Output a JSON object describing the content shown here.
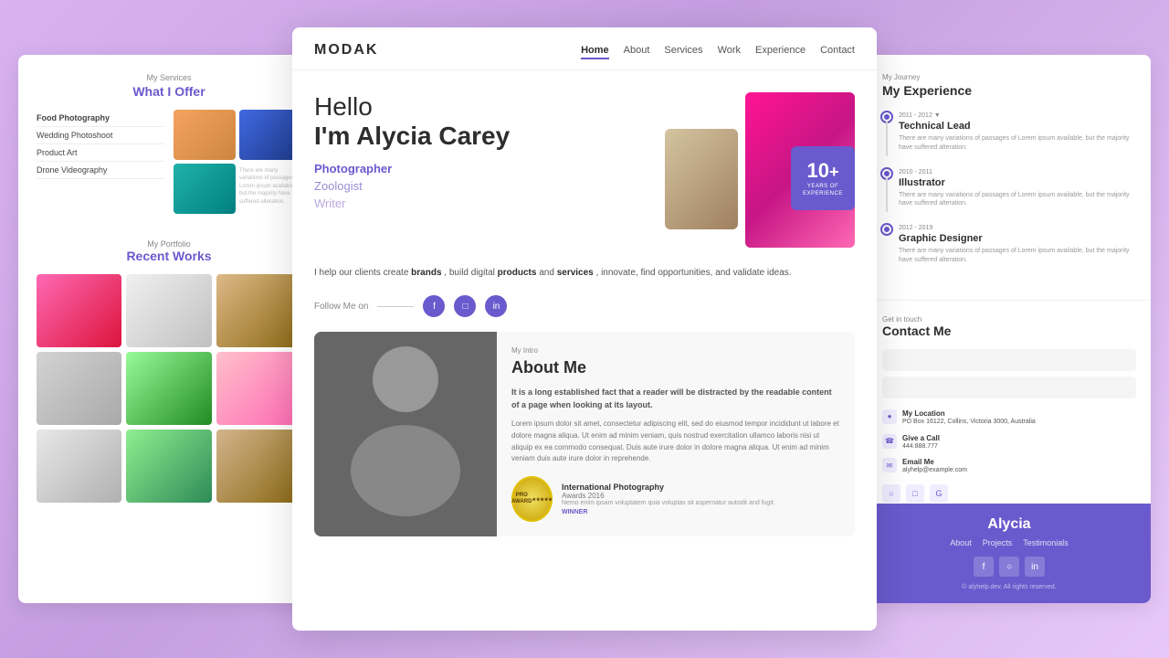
{
  "brand": {
    "logo": "MODAK"
  },
  "nav": {
    "links": [
      "Home",
      "About",
      "Services",
      "Work",
      "Experience",
      "Contact"
    ],
    "active": "Home"
  },
  "hero": {
    "greeting": "Hello",
    "intro": "I'm ",
    "name": "Alycia Carey",
    "roles": [
      "Photographer",
      "Zoologist",
      "Writer"
    ],
    "description": "I help our clients create",
    "desc_brands": "brands",
    "desc_mid": ", build digital",
    "desc_products": "products",
    "desc_and": "and",
    "desc_services": "services",
    "desc_end": ", innovate, find opportunities, and validate ideas.",
    "follow_label": "Follow Me on",
    "experience": {
      "number": "10",
      "plus": "+",
      "line1": "YEARS OF",
      "line2": "EXPERIENCE"
    }
  },
  "about": {
    "section_label": "My Intro",
    "title": "About Me",
    "tagline": "It is a long established fact that a reader will be distracted by the readable content of a page when looking at its layout.",
    "body": "Lorem ipsum dolor sit amet, consectetur adipiscing elit, sed do eiusmod tempor incididunt ut labore et dolore magna aliqua. Ut enim ad minim veniam, quis nostrud exercitation ullamco laboris nisi ut aliquip ex ea commodo consequat. Duis aute irure dolor in dolore magna aliqua. Ut enim ad minim veniam duis aute irure dolor in reprehende.",
    "award": {
      "badge": "PRO\nAWARD",
      "name": "International Photography",
      "year": "Awards 2016",
      "desc": "Nemo enim ipsam voluptatem quia voluptas sit aspernatur autodit and fugit.",
      "winner": "WINNER"
    }
  },
  "experience": {
    "section_label": "My Journey",
    "title": "My Experience",
    "items": [
      {
        "years": "2011 - 2012 ▼",
        "role": "Technical Lead",
        "desc": "There are many variations of passages of Lorem ipsum available, but the majority have suffered alteration."
      },
      {
        "years": "2010 - 2011",
        "role": "Illustrator",
        "desc": "There are many variations of passages of Lorem ipsum available, but the majority have suffered alteration."
      },
      {
        "years": "2012 - 2019",
        "role": "Graphic Designer",
        "desc": "There are many variations of passages of Lorem ipsum available, but the majority have suffered alteration."
      }
    ]
  },
  "contact": {
    "section_label": "Get in touch",
    "title": "Contact Me",
    "location_label": "My Location",
    "location_value": "PO Box 16122, Collins, Victoria 3000, Australia",
    "phone_label": "Give a Call",
    "phone_value": "444.888.777",
    "email_label": "Email Me",
    "email_value": "alyhelp@example.com"
  },
  "services": {
    "section_label": "My Services",
    "title": "What I Offer",
    "items": [
      "Food Photography",
      "Wedding Photoshoot",
      "Product Art",
      "Drone Videography"
    ]
  },
  "portfolio": {
    "section_label": "My Portfolio",
    "title": "Recent Works"
  },
  "footer": {
    "name": "Alycia",
    "links": [
      "About",
      "Projects",
      "Testimonials"
    ],
    "copyright": "© alyhelp.dev. All rights reserved."
  }
}
